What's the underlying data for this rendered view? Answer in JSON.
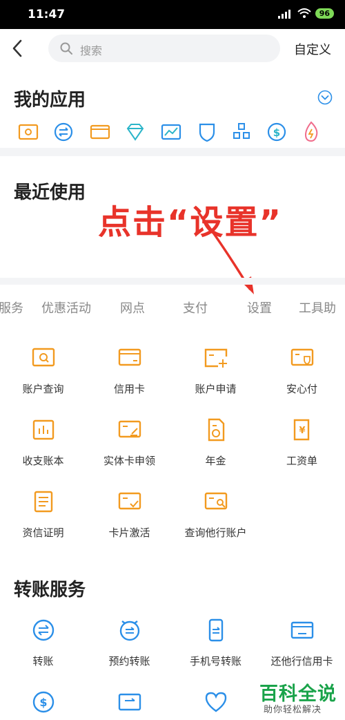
{
  "status_bar": {
    "time": "11:47",
    "battery": "96"
  },
  "top_bar": {
    "search_placeholder": "搜索",
    "customize_label": "自定义"
  },
  "my_apps": {
    "title": "我的应用",
    "icons": [
      "account-icon",
      "transfer-icon",
      "card-icon",
      "diamond-icon",
      "chart-icon",
      "shield-icon",
      "grid-icon",
      "dollar-icon",
      "flame-icon"
    ]
  },
  "recent": {
    "title": "最近使用"
  },
  "annotation": {
    "text": "点击“设置”"
  },
  "tabs": [
    "服务",
    "优惠活动",
    "网点",
    "支付",
    "设置",
    "工具助"
  ],
  "services": [
    {
      "label": "账户查询",
      "icon": "account-query-icon"
    },
    {
      "label": "信用卡",
      "icon": "credit-card-icon"
    },
    {
      "label": "账户申请",
      "icon": "account-apply-icon"
    },
    {
      "label": "安心付",
      "icon": "secure-pay-icon"
    },
    {
      "label": "收支账本",
      "icon": "ledger-icon"
    },
    {
      "label": "实体卡申领",
      "icon": "physical-card-icon"
    },
    {
      "label": "年金",
      "icon": "annuity-icon"
    },
    {
      "label": "工资单",
      "icon": "payslip-icon"
    },
    {
      "label": "资信证明",
      "icon": "credit-certificate-icon"
    },
    {
      "label": "卡片激活",
      "icon": "card-activate-icon"
    },
    {
      "label": "查询他行账户",
      "icon": "other-bank-query-icon"
    }
  ],
  "transfer_section": {
    "title": "转账服务",
    "items": [
      {
        "label": "转账",
        "icon": "transfer-icon"
      },
      {
        "label": "预约转账",
        "icon": "scheduled-transfer-icon"
      },
      {
        "label": "手机号转账",
        "icon": "phone-transfer-icon"
      },
      {
        "label": "还他行信用卡",
        "icon": "repay-card-icon"
      }
    ]
  },
  "watermark": {
    "title": "百科全说",
    "subtitle": "助你轻松解决"
  },
  "colors": {
    "orange": "#f29a1f",
    "blue": "#2b8fe8",
    "red": "#e8332a",
    "green": "#1aa34a"
  }
}
